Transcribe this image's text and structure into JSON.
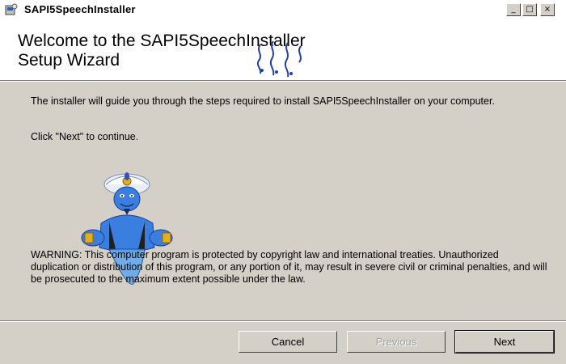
{
  "window": {
    "title": "SAPI5SpeechInstaller",
    "controls": {
      "minimize": "_",
      "maximize": "□",
      "close": "×"
    }
  },
  "header": {
    "title": "Welcome to the SAPI5SpeechInstaller\nSetup Wizard"
  },
  "body": {
    "intro": "The installer will guide you through the steps required to install SAPI5SpeechInstaller on your computer.",
    "continue": "Click \"Next\" to continue.",
    "warning": "WARNING: This computer program is protected by copyright law and international treaties. Unauthorized duplication or distribution of this program, or any portion of it, may result in severe civil or criminal penalties, and will be prosecuted to the maximum extent possible under the law."
  },
  "buttons": {
    "cancel": "Cancel",
    "previous": "Previous",
    "next": "Next"
  },
  "colors": {
    "face": "#d4d0c8",
    "header_bg": "#ffffff",
    "genie_body": "#3a7fe0"
  },
  "icons": [
    "installer-app-icon",
    "speech-logo-icon",
    "genie-mascot-icon"
  ]
}
